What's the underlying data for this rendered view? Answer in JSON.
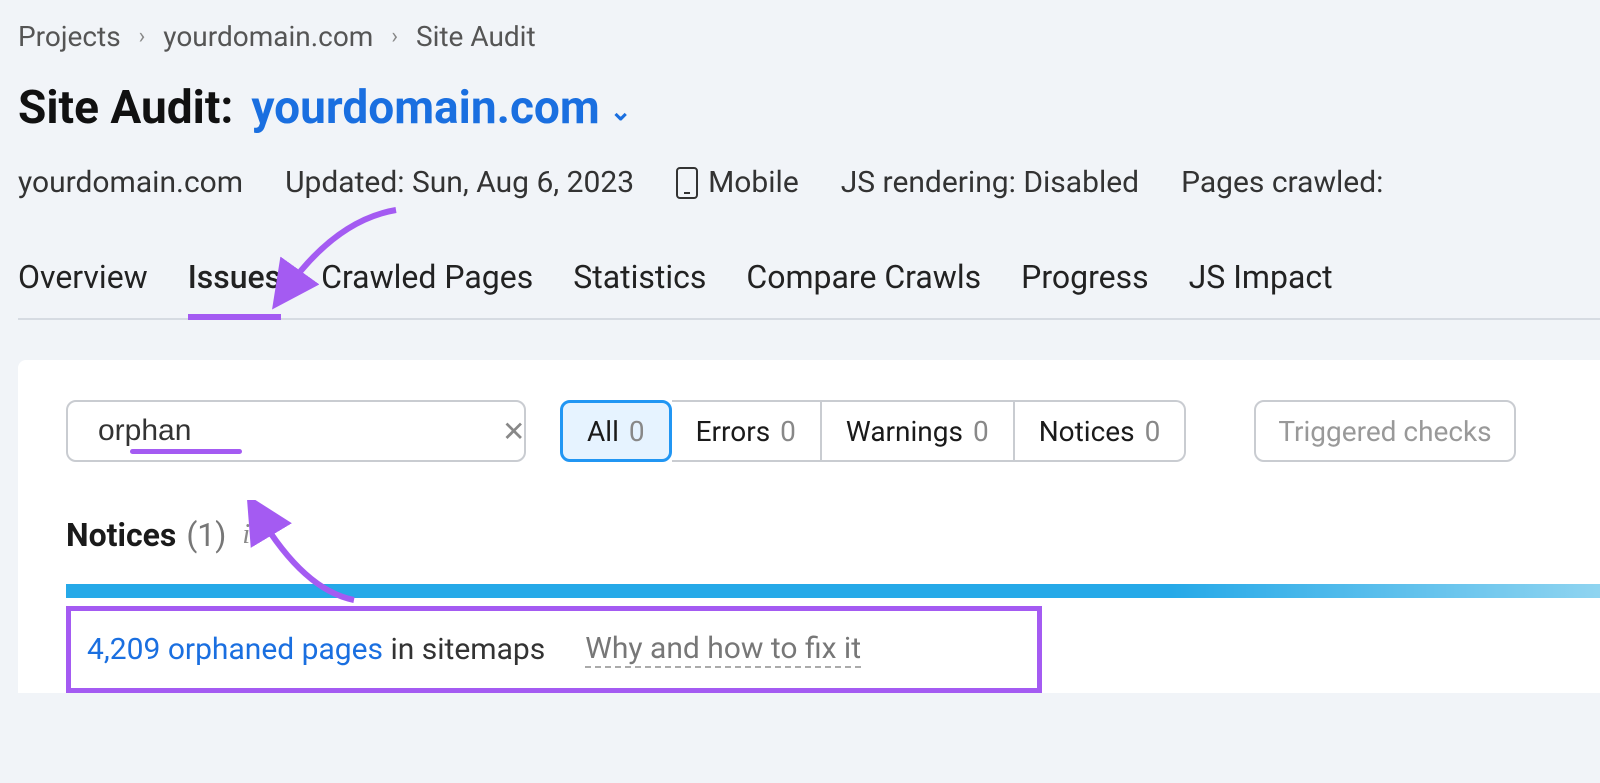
{
  "breadcrumb": {
    "projects": "Projects",
    "domain": "yourdomain.com",
    "section": "Site Audit"
  },
  "title": {
    "prefix": "Site Audit:",
    "domain": "yourdomain.com"
  },
  "meta": {
    "domain": "yourdomain.com",
    "updated": "Updated: Sun, Aug 6, 2023",
    "device": "Mobile",
    "js": "JS rendering: Disabled",
    "crawled": "Pages crawled:"
  },
  "tabs": {
    "overview": "Overview",
    "issues": "Issues",
    "crawled": "Crawled Pages",
    "statistics": "Statistics",
    "compare": "Compare Crawls",
    "progress": "Progress",
    "jsimpact": "JS Impact"
  },
  "search": {
    "value": "orphan"
  },
  "filters": {
    "all": {
      "label": "All",
      "count": "0"
    },
    "errors": {
      "label": "Errors",
      "count": "0"
    },
    "warnings": {
      "label": "Warnings",
      "count": "0"
    },
    "notices": {
      "label": "Notices",
      "count": "0"
    },
    "triggered": "Triggered checks"
  },
  "section": {
    "notices_label": "Notices",
    "notices_count": "(1)"
  },
  "issue": {
    "count": "4,209",
    "term": "orphaned pages",
    "suffix": " in sitemaps",
    "fix": "Why and how to fix it"
  }
}
